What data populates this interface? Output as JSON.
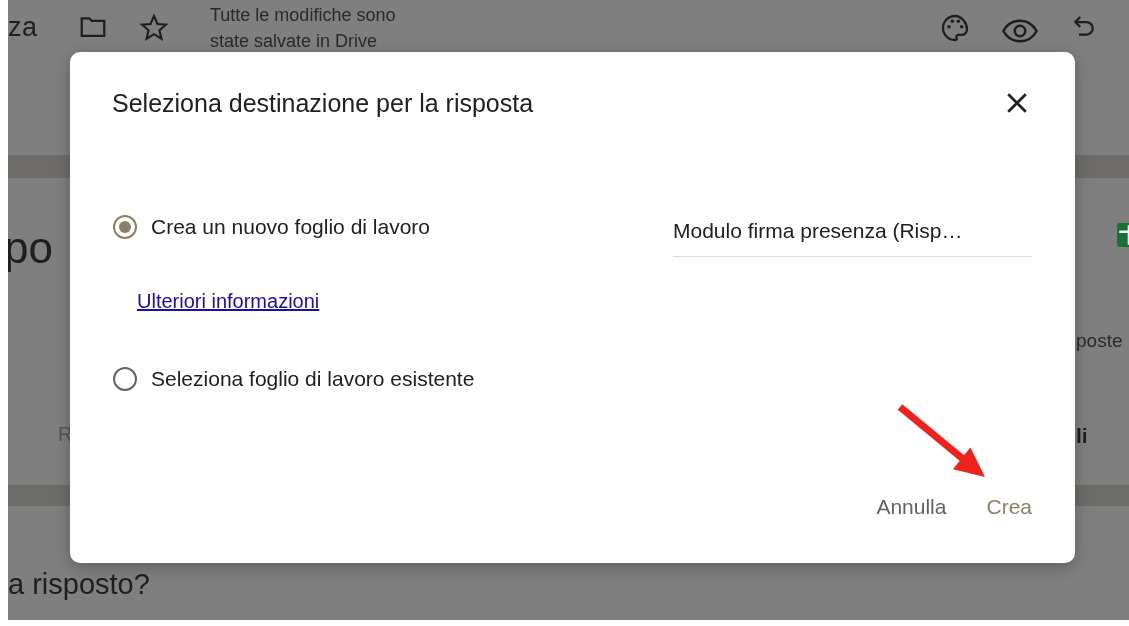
{
  "background": {
    "header": {
      "title_fragment": "za",
      "status": [
        "Tutte le modifiche sono",
        "state salvate in Drive"
      ]
    },
    "left_fragments": [
      "po",
      "R"
    ],
    "right_fragments": [
      "poste",
      "li"
    ],
    "question_fragment": "a risposto?"
  },
  "dialog": {
    "title": "Seleziona destinazione per la risposta",
    "options": [
      {
        "label": "Crea un nuovo foglio di lavoro",
        "selected": true,
        "sheet_name": "Modulo firma presenza (Risp…",
        "link": "Ulteriori informazioni"
      },
      {
        "label": "Seleziona foglio di lavoro esistente",
        "selected": false
      }
    ],
    "buttons": [
      {
        "label": "Annulla",
        "kind": "cancel"
      },
      {
        "label": "Crea",
        "kind": "confirm"
      }
    ]
  }
}
